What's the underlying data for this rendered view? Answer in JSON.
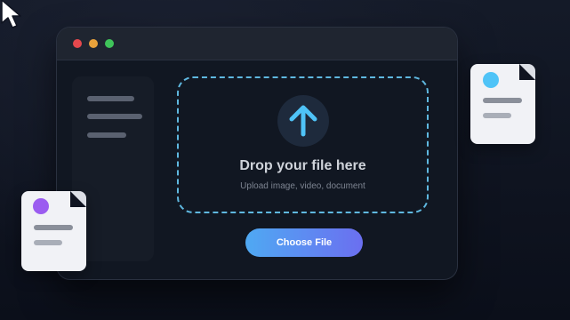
{
  "window": {
    "controls": [
      "close",
      "minimize",
      "maximize"
    ]
  },
  "upload": {
    "icon": "upload-arrow-icon",
    "title": "Drop your file here",
    "subtitle": "Upload image, video, document",
    "button_label": "Choose File"
  },
  "cards": [
    {
      "name": "file-card-right",
      "accent": "#4fc3f7"
    },
    {
      "name": "file-card-left",
      "accent": "#9b5cf0"
    }
  ],
  "colors": {
    "background": "#0f1320",
    "window": "#111722",
    "dropzone_border": "#5fb8e0",
    "arrow": "#4fc3f7",
    "button_gradient_start": "#4fa9f3",
    "button_gradient_end": "#6b6ff0",
    "dot_red": "#e5484d",
    "dot_yellow": "#e9a23b",
    "dot_green": "#3fc45a"
  }
}
